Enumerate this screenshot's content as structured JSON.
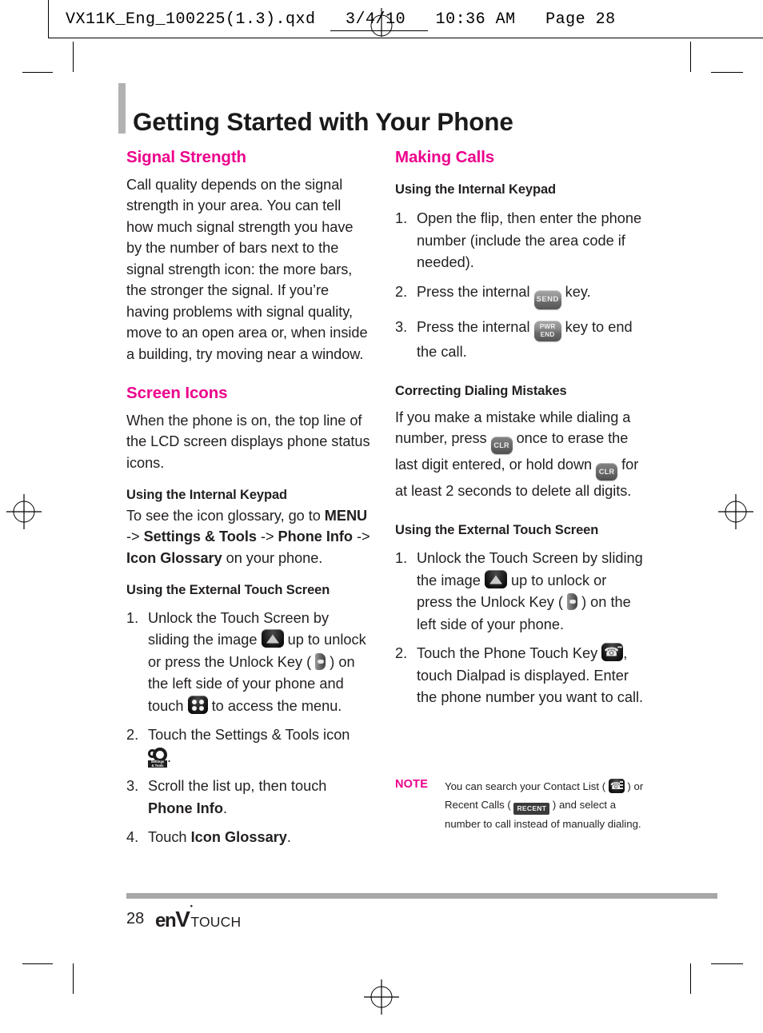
{
  "prepress": {
    "header_line": "VX11K_Eng_100225(1.3).qxd   3/4/10   10:36 AM   Page 28"
  },
  "page": {
    "title": "Getting Started with Your Phone"
  },
  "left_column": {
    "signal_strength": {
      "heading": "Signal Strength",
      "body": "Call quality depends on the signal strength in your area. You can tell how much signal strength you have by the number of bars next to the signal strength icon: the more bars, the stronger the signal. If you’re having problems with signal quality, move to an open area or, when inside a building, try moving near a window."
    },
    "screen_icons": {
      "heading": "Screen Icons",
      "body": "When the phone is on, the top line of the LCD screen displays phone status icons.",
      "internal_keypad": {
        "heading": "Using the Internal Keypad",
        "line_1": "To see the icon glossary, go to ",
        "menu": "MENU",
        "arrow_1": " -> ",
        "settings_tools": "Settings & Tools",
        "arrow_2": " -> ",
        "phone_info": "Phone Info",
        "arrow_3": " -> ",
        "icon_glossary": "Icon Glossary",
        "line_end": " on your phone."
      },
      "external_touch": {
        "heading": "Using the External Touch Screen",
        "steps": [
          {
            "num": "1.",
            "part_1": "Unlock the Touch Screen by sliding the image ",
            "icon_1": "unlock-slider-icon",
            "part_2": " up to unlock or press the Unlock Key ( ",
            "icon_2": "unlock-key-icon",
            "part_3": " ) on the left side of your phone and touch ",
            "icon_3": "menu-grid-icon",
            "part_4": " to access the menu."
          },
          {
            "num": "2.",
            "part_1": "Touch the Settings & Tools icon ",
            "icon_1": "settings-tools-icon",
            "part_2": "."
          },
          {
            "num": "3.",
            "part_1": "Scroll the list up, then touch ",
            "bold_1": "Phone Info",
            "part_2": "."
          },
          {
            "num": "4.",
            "part_1": "Touch ",
            "bold_1": "Icon Glossary",
            "part_2": "."
          }
        ]
      }
    }
  },
  "right_column": {
    "making_calls": {
      "heading": "Making Calls",
      "internal_keypad": {
        "heading": "Using the Internal Keypad",
        "steps": [
          {
            "num": "1.",
            "part_1": "Open the flip, then enter the phone number (include the area code if needed)."
          },
          {
            "num": "2.",
            "part_1": "Press the internal ",
            "key_label": "SEND",
            "part_2": " key."
          },
          {
            "num": "3.",
            "part_1": "Press the internal ",
            "key_label_top": "PWR",
            "key_label_bottom": "END",
            "part_2": " key to end the call."
          }
        ]
      },
      "correcting": {
        "heading": "Correcting Dialing Mistakes",
        "part_1": "If you make a mistake while dialing a number, press ",
        "key_1": "CLR",
        "part_2": " once to erase the last digit entered, or hold down ",
        "key_2": "CLR",
        "part_3": " for at least 2 seconds to delete all digits."
      },
      "external_touch": {
        "heading": "Using the External Touch Screen",
        "steps": [
          {
            "num": "1.",
            "part_1": "Unlock the Touch Screen by sliding the image ",
            "icon_1": "unlock-slider-icon",
            "part_2": " up to unlock or press the Unlock Key ( ",
            "icon_2": "unlock-key-icon",
            "part_3": " ) on the left side of your phone."
          },
          {
            "num": "2.",
            "part_1": "Touch the Phone Touch Key ",
            "icon_1": "phone-touch-key-icon",
            "part_2": ", touch Dialpad is displayed. Enter the phone number you want to call."
          }
        ]
      }
    },
    "note": {
      "label": "NOTE",
      "part_1": "You can search your Contact List ( ",
      "icon_1": "contact-list-icon",
      "part_2": " ) or Recent Calls ( ",
      "icon_2_label": "RECENT",
      "part_3": " ) and select a number to call instead of manually dialing."
    }
  },
  "footer": {
    "page_number": "28",
    "logo_en": "en",
    "logo_v": "V",
    "logo_touch": "TOUCH"
  },
  "colors": {
    "accent_magenta": "#ec008c",
    "text": "#231f20",
    "rule_gray": "#a7a7a7",
    "title_bar_gray": "#b2b2b2"
  }
}
